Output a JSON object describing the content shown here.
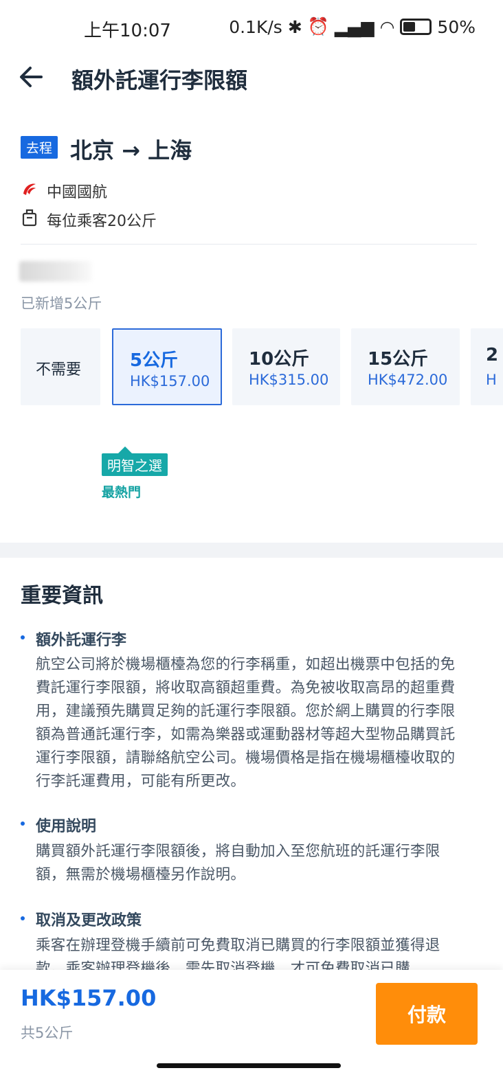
{
  "status_bar": {
    "time": "上午10:07",
    "network_speed": "0.1K/s",
    "battery": "50%",
    "battery_level": 0.5
  },
  "header": {
    "title": "額外託運行李限額"
  },
  "flight": {
    "direction_badge": "去程",
    "route": "北京 → 上海",
    "airline": "中國國航",
    "allowance": "每位乘客20公斤"
  },
  "baggage": {
    "added_text": "已新增5公斤",
    "options": [
      {
        "label": "不需要"
      },
      {
        "weight": "5公斤",
        "price": "HK$157.00",
        "selected": true
      },
      {
        "weight": "10公斤",
        "price": "HK$315.00"
      },
      {
        "weight": "15公斤",
        "price": "HK$472.00"
      },
      {
        "weight": "2",
        "price": "H"
      }
    ],
    "recommend_tag": "明智之選",
    "popular_label": "最熱門"
  },
  "info": {
    "title": "重要資訊",
    "sections": [
      {
        "heading": "額外託運行李",
        "body": "航空公司將於機場櫃檯為您的行李稱重，如超出機票中包括的免費託運行李限額，將收取高額超重費。為免被收取高昂的超重費用，建議預先購買足夠的託運行李限額。您於網上購買的行李限額為普通託運行李，如需為樂器或運動器材等超大型物品購買託運行李限額，請聯絡航空公司。機場價格是指在機場櫃檯收取的行李託運費用，可能有所更改。"
      },
      {
        "heading": "使用說明",
        "body": "購買額外託運行李限額後，將自動加入至您航班的託運行李限額，無需於機場櫃檯另作說明。"
      },
      {
        "heading": "取消及更改政策",
        "body": "乘客在辦理登機手續前可免費取消已購買的行李限額並獲得退款。乘客辦理登機後，需先取消登機，才可免費取消已購"
      }
    ]
  },
  "footer": {
    "total": "HK$157.00",
    "total_weight": "共5公斤",
    "pay_label": "付款"
  },
  "colors": {
    "accent": "#1769e0",
    "pay": "#ff8d0a",
    "teal": "#16a8a8"
  }
}
